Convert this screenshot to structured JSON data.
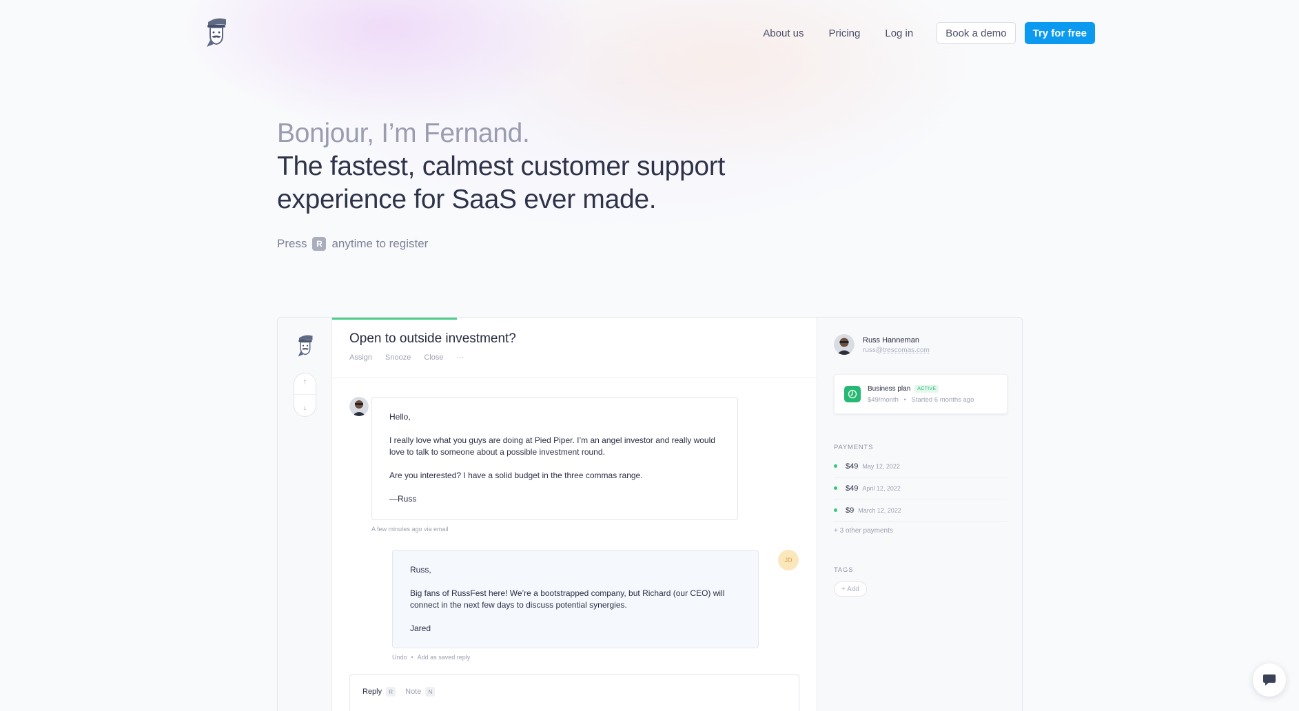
{
  "nav": {
    "about": "About us",
    "pricing": "Pricing",
    "login": "Log in",
    "demo": "Book a demo",
    "try": "Try for free",
    "accent": "#0c9af0"
  },
  "hero": {
    "greeting": "Bonjour, I’m Fernand.",
    "title_line1": "The fastest, calmest customer support",
    "title_line2": "experience for SaaS ever made.",
    "press_prefix": "Press",
    "press_key": "R",
    "press_suffix": "anytime to register"
  },
  "app": {
    "conversation": {
      "title": "Open to outside investment?",
      "actions": [
        "Assign",
        "Snooze",
        "Close",
        "···"
      ],
      "message": {
        "p1": "Hello,",
        "p2": "I really love what you guys are doing at Pied Piper. I’m an angel investor and really would love to talk to someone about a possible investment round.",
        "p3": "Are you interested? I have a solid budget in the three commas range.",
        "p4": "—Russ",
        "meta": "A few minutes ago via email"
      },
      "reply": {
        "avatar_initials": "JD",
        "p1": "Russ,",
        "p2": "Big fans of RussFest here! We’re a bootstrapped company, but Richard (our CEO) will connect in the next few days to discuss potential synergies.",
        "p3": "Jared",
        "undo": "Undo",
        "separator": "•",
        "saved": "Add as saved reply"
      },
      "composer": {
        "reply_tab": "Reply",
        "reply_key": "R",
        "note_tab": "Note",
        "note_key": "N"
      }
    },
    "customer": {
      "name": "Russ Hanneman",
      "email_user": "russ@",
      "email_domain": "trescomas.com",
      "plan_name": "Business plan",
      "plan_badge": "ACTIVE",
      "plan_price": "$49/month",
      "plan_dot": "•",
      "plan_started": "Started 6 months ago",
      "payments_label": "PAYMENTS",
      "payments": [
        {
          "amount": "$49",
          "date": "May 12, 2022"
        },
        {
          "amount": "$49",
          "date": "April 12, 2022"
        },
        {
          "amount": "$9",
          "date": "March 12, 2022"
        }
      ],
      "more_payments": "+ 3 other payments",
      "tags_label": "TAGS",
      "tag_add": "+ Add"
    }
  }
}
